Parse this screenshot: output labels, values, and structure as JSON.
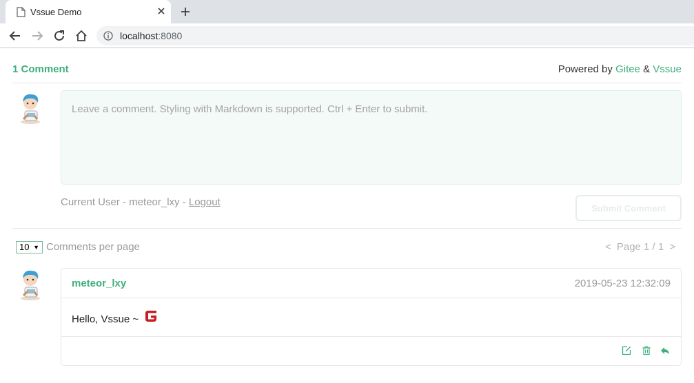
{
  "browser": {
    "tab_title": "Vssue Demo",
    "url_host": "localhost",
    "url_port": ":8080"
  },
  "vssue": {
    "comment_count": "1 Comment",
    "powered_by": "Powered by",
    "powered_gitee": "Gitee",
    "powered_amp": "&",
    "powered_vssue": "Vssue",
    "textarea_placeholder": "Leave a comment. Styling with Markdown is supported. Ctrl + Enter to submit.",
    "current_user_prefix": "Current User - meteor_lxy - ",
    "logout_label": "Logout",
    "submit_label": "Submit Comment",
    "per_page_value": "10",
    "per_page_label": "Comments per page",
    "pager_prev": "<",
    "pager_text": "Page 1 / 1",
    "pager_next": ">"
  },
  "comments": [
    {
      "author": "meteor_lxy",
      "date": "2019-05-23 12:32:09",
      "text": "Hello, Vssue ~"
    }
  ],
  "colors": {
    "accent": "#3eaf7c",
    "gitee_red": "#c71d23"
  },
  "icons": [
    "page-icon",
    "close-icon",
    "plus-icon",
    "back-arrow-icon",
    "forward-arrow-icon",
    "reload-icon",
    "home-icon",
    "info-icon",
    "edit-icon",
    "trash-icon",
    "reply-icon",
    "gitee-logo"
  ]
}
